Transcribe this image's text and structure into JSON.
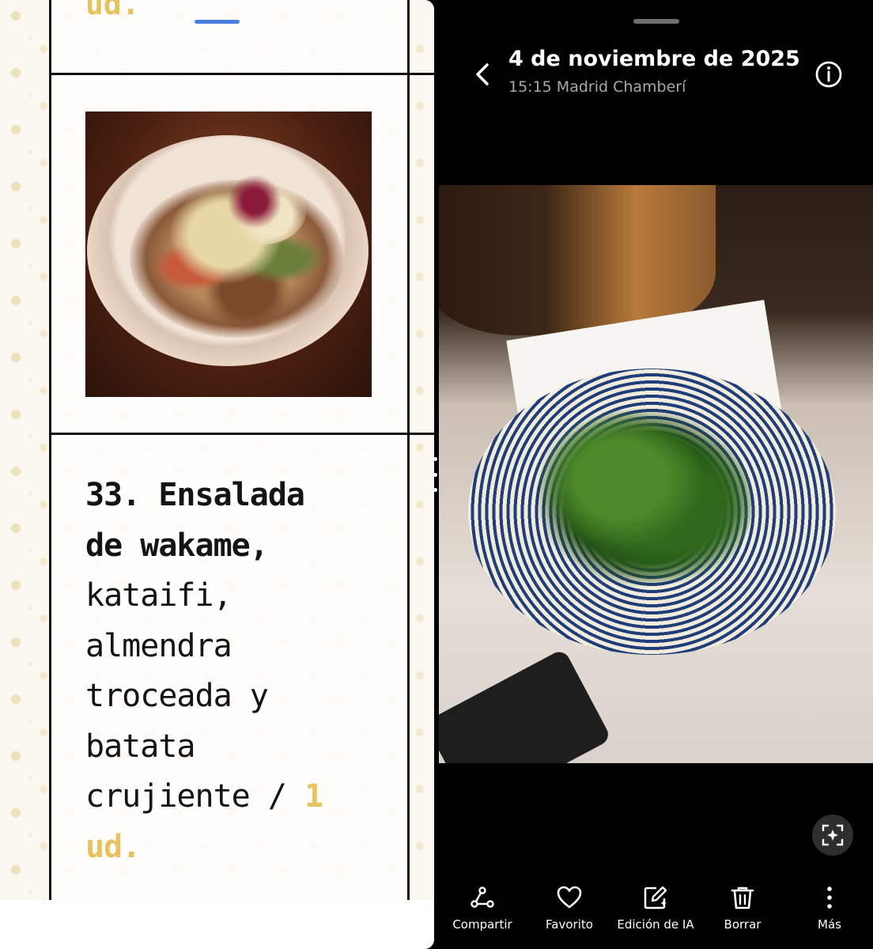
{
  "menu_page": {
    "previous_price_tail": "ud.",
    "dish": {
      "number": "33.",
      "name_bold": "Ensalada de wakame,",
      "name_rest": "kataifi, almendra troceada y batata crujiente /",
      "price": "1 ud."
    },
    "accent_color": "#e8c25c"
  },
  "gallery": {
    "date": "4 de noviembre de 2025",
    "time_location": "15:15 Madrid Chamberí",
    "toolbar": {
      "share": "Compartir",
      "favorite": "Favorito",
      "ai_edit": "Edición de IA",
      "delete": "Borrar",
      "more": "Más"
    },
    "icons": {
      "back": "chevron-left-icon",
      "info": "info-icon",
      "ai_select": "ai-select-icon",
      "share": "share-icon",
      "favorite": "heart-icon",
      "ai_edit": "ai-edit-icon",
      "delete": "trash-icon",
      "more": "more-vertical-icon"
    }
  }
}
